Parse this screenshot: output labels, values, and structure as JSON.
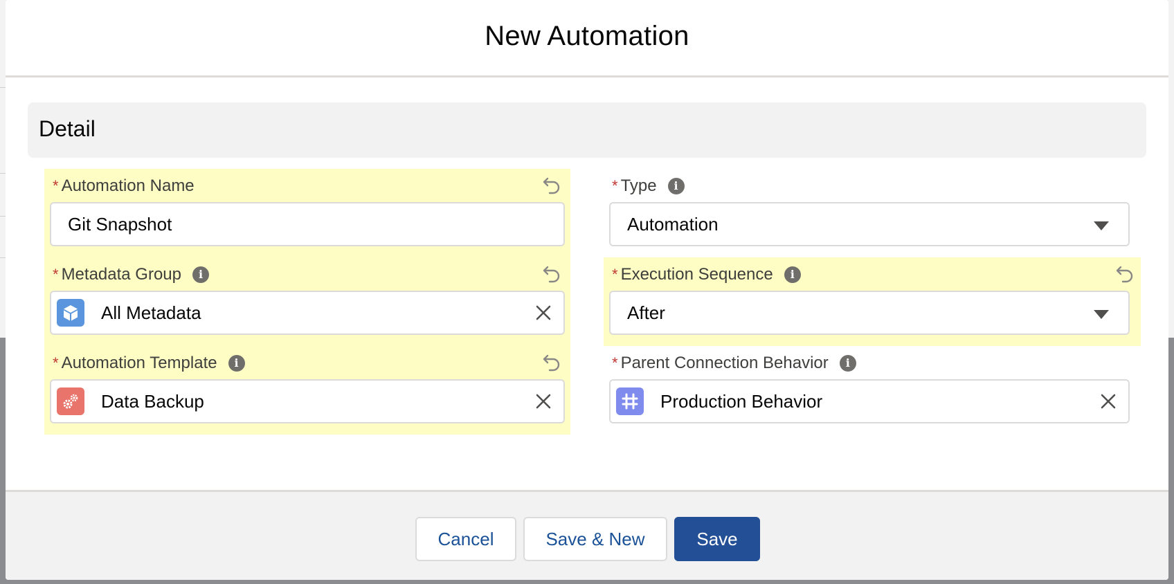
{
  "modal": {
    "title": "New Automation"
  },
  "section": {
    "title": "Detail"
  },
  "fields": {
    "automation_name": {
      "label": "Automation Name",
      "value": "Git Snapshot"
    },
    "type": {
      "label": "Type",
      "value": "Automation"
    },
    "metadata_group": {
      "label": "Metadata Group",
      "value": "All Metadata"
    },
    "execution_sequence": {
      "label": "Execution Sequence",
      "value": "After"
    },
    "automation_template": {
      "label": "Automation Template",
      "value": "Data Backup"
    },
    "parent_connection_behavior": {
      "label": "Parent Connection Behavior",
      "value": "Production Behavior"
    }
  },
  "required_marker": "*",
  "footer": {
    "cancel_label": "Cancel",
    "save_new_label": "Save & New",
    "save_label": "Save"
  },
  "colors": {
    "changed_highlight": "#fdfdc4",
    "brand_button": "#234f96",
    "metadata_icon_bg": "#5a95dd",
    "template_icon_bg": "#e8746b",
    "behavior_icon_bg": "#7f8ced"
  }
}
